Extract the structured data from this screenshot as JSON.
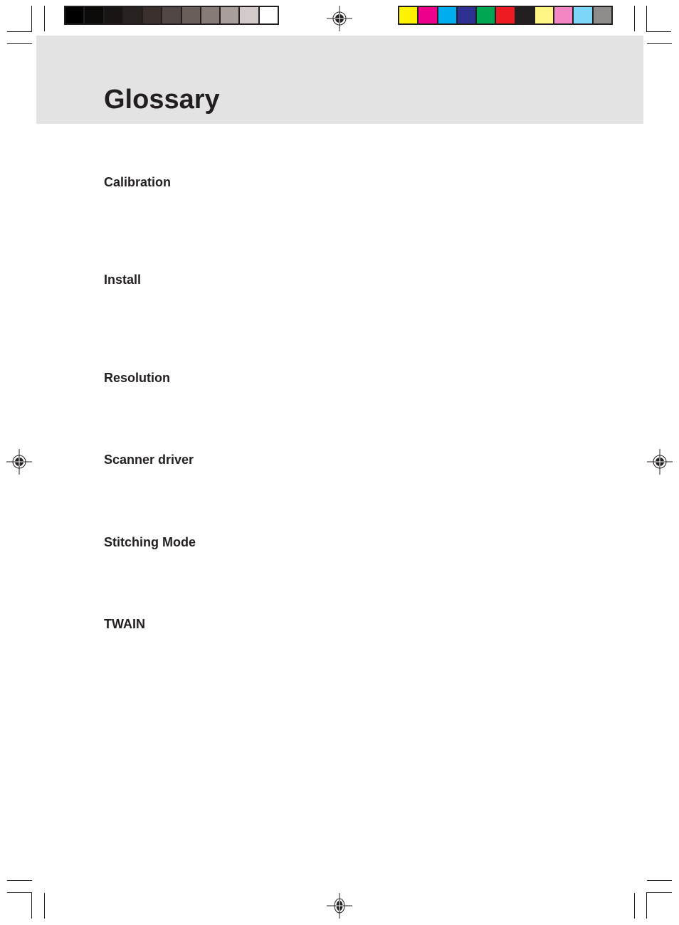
{
  "page": {
    "title": "Glossary"
  },
  "terms": [
    {
      "label": "Calibration"
    },
    {
      "label": "Install"
    },
    {
      "label": "Resolution"
    },
    {
      "label": "Scanner driver"
    },
    {
      "label": "Stitching Mode"
    },
    {
      "label": "TWAIN"
    }
  ],
  "print_marks": {
    "grayscale_bar": [
      "#000000",
      "#0b0a08",
      "#181514",
      "#27221f",
      "#3a302d",
      "#514744",
      "#6a5e5b",
      "#877b78",
      "#a89e9b",
      "#d3cbca",
      "#ffffff"
    ],
    "color_bar": [
      "#fff200",
      "#ec008c",
      "#00aeef",
      "#2e3192",
      "#00a651",
      "#ed1c24",
      "#231f20",
      "#fff685",
      "#f386c5",
      "#7dd6f7",
      "#8f8c8c"
    ]
  },
  "colors": {
    "header_band": "#e3e3e3",
    "text": "#231f20"
  }
}
